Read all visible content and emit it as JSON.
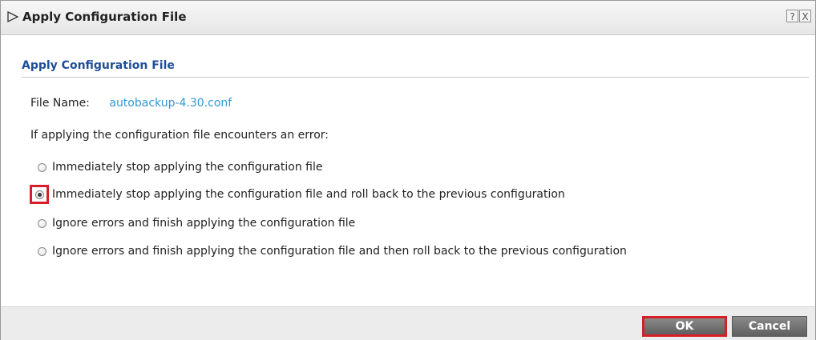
{
  "dialog": {
    "title": "Apply Configuration File",
    "help_label": "?",
    "close_label": "X"
  },
  "section": {
    "title": "Apply Configuration File",
    "file_name_label": "File Name:",
    "file_name_value": "autobackup-4.30.conf",
    "prompt": "If applying the configuration file encounters an error:"
  },
  "options": [
    {
      "label": "Immediately stop applying the configuration file",
      "checked": false
    },
    {
      "label": "Immediately stop applying the configuration file and roll back to the previous configuration",
      "checked": true
    },
    {
      "label": "Ignore errors and finish applying the configuration file",
      "checked": false
    },
    {
      "label": "Ignore errors and finish applying the configuration file and then roll back to the previous configuration",
      "checked": false
    }
  ],
  "buttons": {
    "ok_label": "OK",
    "cancel_label": "Cancel"
  },
  "colors": {
    "section_title": "#1f4e98",
    "file_name_value": "#2e9ad6",
    "highlight": "#d61f26"
  }
}
